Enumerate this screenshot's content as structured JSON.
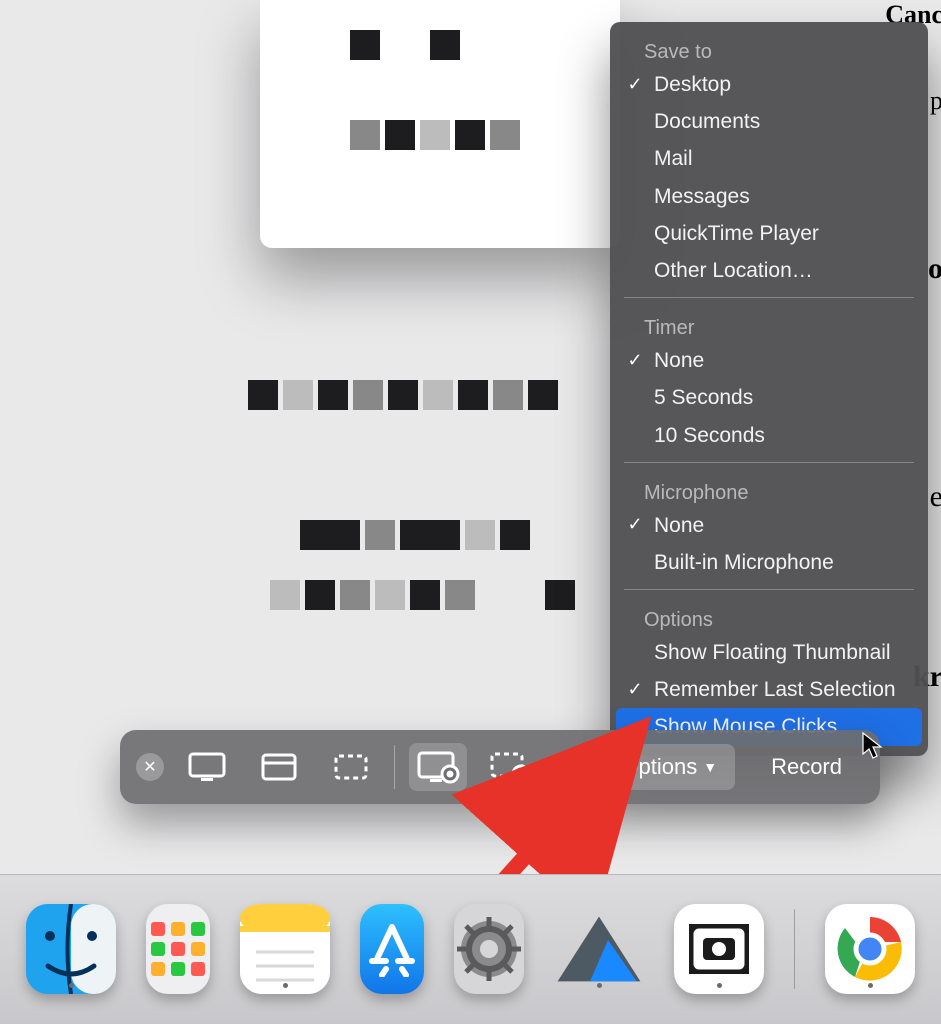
{
  "menu": {
    "sections": [
      {
        "head": "Save to",
        "items": [
          {
            "label": "Desktop",
            "checked": true
          },
          {
            "label": "Documents",
            "checked": false
          },
          {
            "label": "Mail",
            "checked": false
          },
          {
            "label": "Messages",
            "checked": false
          },
          {
            "label": "QuickTime Player",
            "checked": false
          },
          {
            "label": "Other Location…",
            "checked": false
          }
        ]
      },
      {
        "head": "Timer",
        "items": [
          {
            "label": "None",
            "checked": true
          },
          {
            "label": "5 Seconds",
            "checked": false
          },
          {
            "label": "10 Seconds",
            "checked": false
          }
        ]
      },
      {
        "head": "Microphone",
        "items": [
          {
            "label": "None",
            "checked": true
          },
          {
            "label": "Built-in Microphone",
            "checked": false
          }
        ]
      },
      {
        "head": "Options",
        "items": [
          {
            "label": "Show Floating Thumbnail",
            "checked": false
          },
          {
            "label": "Remember Last Selection",
            "checked": true
          },
          {
            "label": "Show Mouse Clicks",
            "checked": false,
            "highlight": true
          }
        ]
      }
    ]
  },
  "toolbar": {
    "options_label": "Options",
    "record_label": "Record"
  },
  "dock": {
    "apps": [
      {
        "name": "finder"
      },
      {
        "name": "launchpad"
      },
      {
        "name": "notes"
      },
      {
        "name": "app-store"
      },
      {
        "name": "system-preferences"
      },
      {
        "name": "triangle-app"
      },
      {
        "name": "screenshot"
      },
      {
        "name": "chrome"
      }
    ]
  },
  "edge_fragments": [
    "Canc",
    "p",
    "o",
    "e",
    "kr"
  ]
}
